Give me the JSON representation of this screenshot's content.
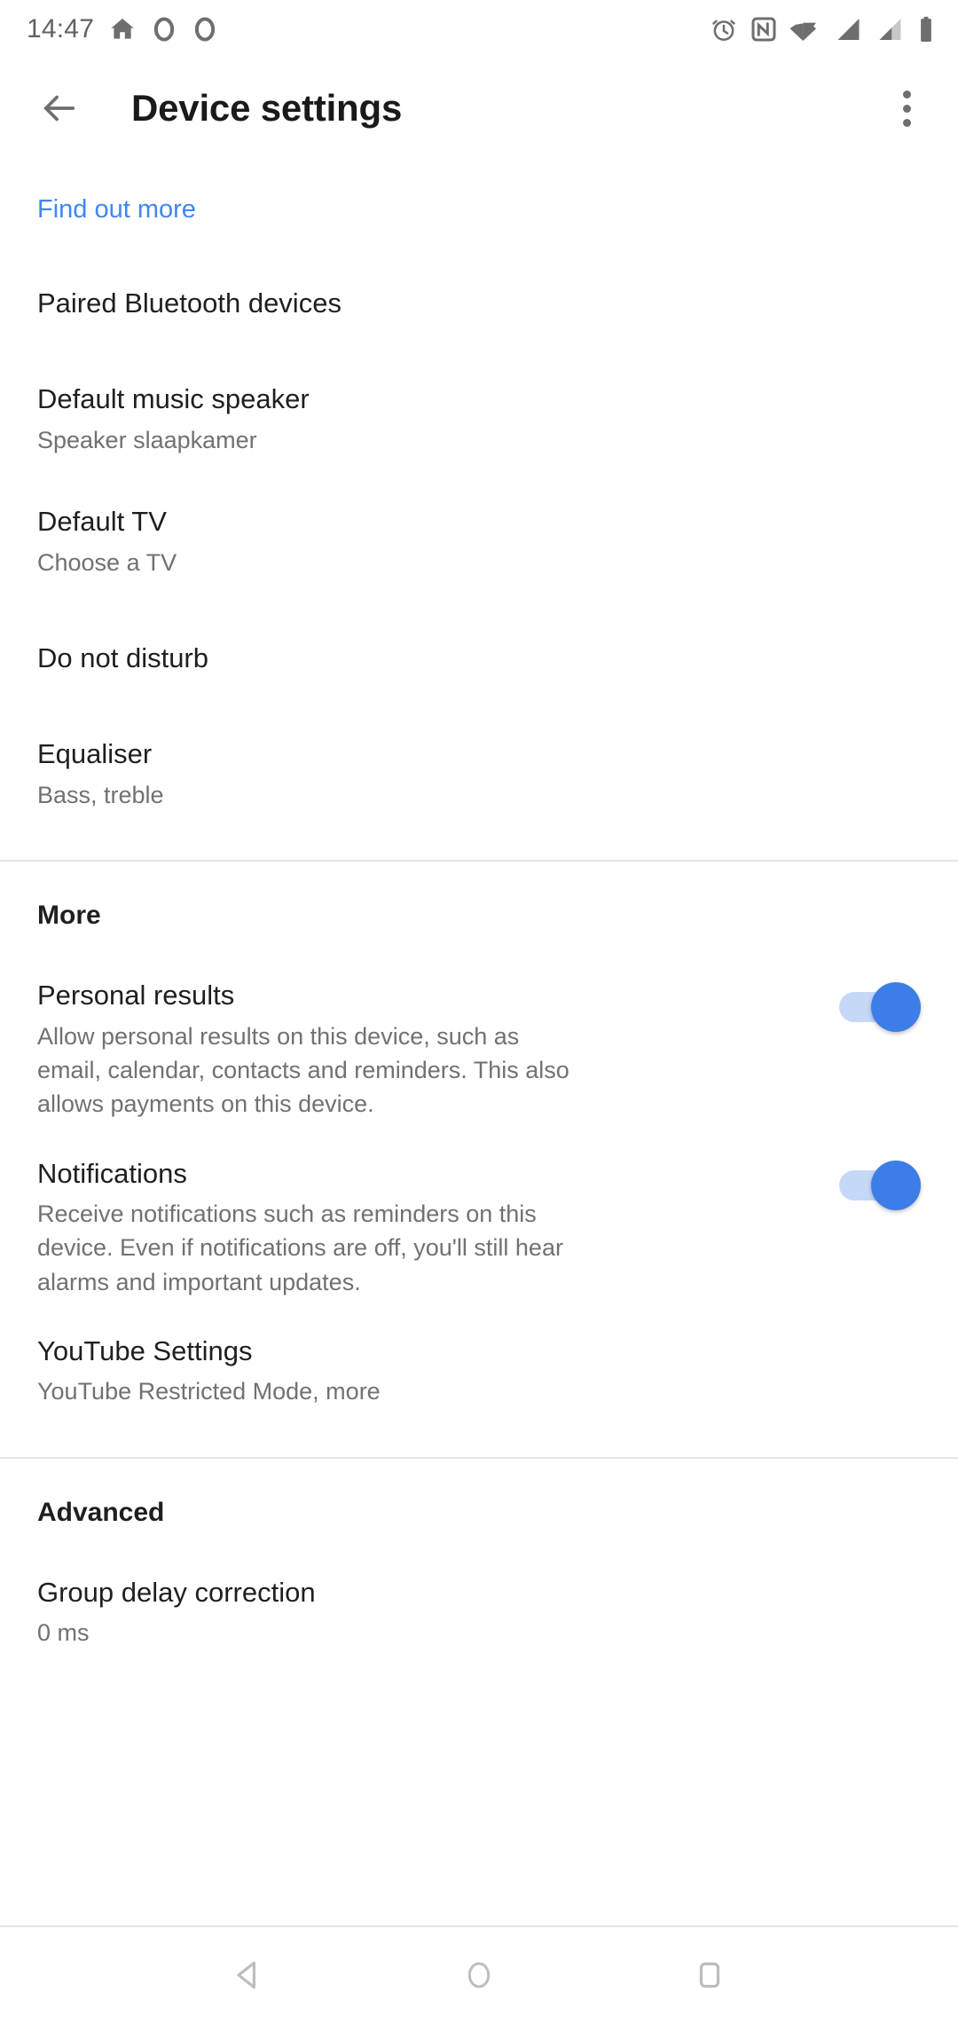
{
  "status_bar": {
    "time": "14:47",
    "left_icons": [
      "home-icon",
      "ring-icon",
      "ring-icon"
    ],
    "right_icons": [
      "alarm-icon",
      "nfc-icon",
      "wifi-icon",
      "signal-full-icon",
      "signal-partial-icon",
      "battery-icon"
    ],
    "icon_color": "#6e6e6e"
  },
  "app_bar": {
    "back_label": "back-arrow",
    "title": "Device settings",
    "overflow_label": "more-options"
  },
  "link": {
    "find_out_more": "Find out more",
    "color": "#4285f4"
  },
  "main": {
    "items": [
      {
        "title": "Paired Bluetooth devices",
        "summary": ""
      },
      {
        "title": "Default music speaker",
        "summary": "Speaker slaapkamer"
      },
      {
        "title": "Default TV",
        "summary": "Choose a TV"
      },
      {
        "title": "Do not disturb",
        "summary": ""
      },
      {
        "title": "Equaliser",
        "summary": "Bass, treble"
      }
    ]
  },
  "more_section": {
    "header": "More",
    "items": [
      {
        "title": "Personal results",
        "summary": "Allow personal results on this device, such as email, calendar, contacts and reminders. This also allows payments on this device.",
        "toggle": "on"
      },
      {
        "title": "Notifications",
        "summary": "Receive notifications such as reminders on this device. Even if notifications are off, you'll still hear alarms and important updates.",
        "toggle": "on"
      },
      {
        "title": "YouTube Settings",
        "summary": "YouTube Restricted Mode, more"
      }
    ]
  },
  "advanced_section": {
    "header": "Advanced",
    "items": [
      {
        "title": "Group delay correction",
        "summary": "0 ms"
      }
    ]
  },
  "nav_bar": {
    "back": "back-triangle-icon",
    "home": "home-circle-icon",
    "recents": "recents-square-icon",
    "color": "#bdbdbd"
  }
}
